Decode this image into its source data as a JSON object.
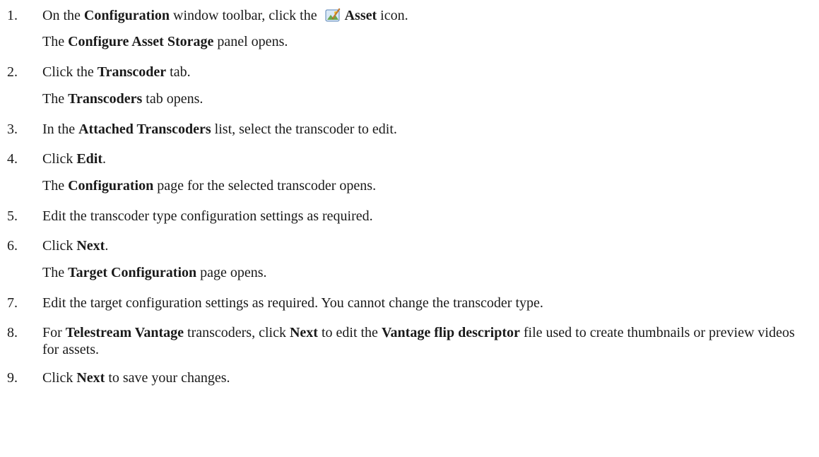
{
  "steps": [
    {
      "number": "1.",
      "parts": [
        "On the ",
        "Configuration",
        " window toolbar, click the ",
        "Asset",
        " icon."
      ],
      "result": [
        "The ",
        "Configure Asset Storage",
        " panel opens."
      ],
      "icon": "asset-storage-icon"
    },
    {
      "number": "2.",
      "parts": [
        "Click the ",
        "Transcoder",
        " tab."
      ],
      "result": [
        "The ",
        "Transcoders",
        " tab opens."
      ]
    },
    {
      "number": "3.",
      "parts": [
        "In the ",
        "Attached Transcoders",
        " list, select the transcoder to edit."
      ]
    },
    {
      "number": "4.",
      "parts": [
        "Click ",
        "Edit",
        "."
      ],
      "result": [
        "The ",
        "Configuration",
        " page for the selected transcoder opens."
      ]
    },
    {
      "number": "5.",
      "parts": [
        "Edit the transcoder type configuration settings as required."
      ]
    },
    {
      "number": "6.",
      "parts": [
        "Click ",
        "Next",
        "."
      ],
      "result": [
        "The ",
        "Target Configuration",
        " page opens."
      ]
    },
    {
      "number": "7.",
      "parts": [
        "Edit the target configuration settings as required. You cannot change the transcoder type."
      ]
    },
    {
      "number": "8.",
      "parts": [
        "For ",
        "Telestream Vantage",
        " transcoders, click ",
        "Next",
        " to edit the ",
        "Vantage flip descriptor",
        " file used to create thumbnails or preview videos for assets."
      ]
    },
    {
      "number": "9.",
      "parts": [
        "Click ",
        "Next",
        " to save your changes."
      ]
    }
  ]
}
